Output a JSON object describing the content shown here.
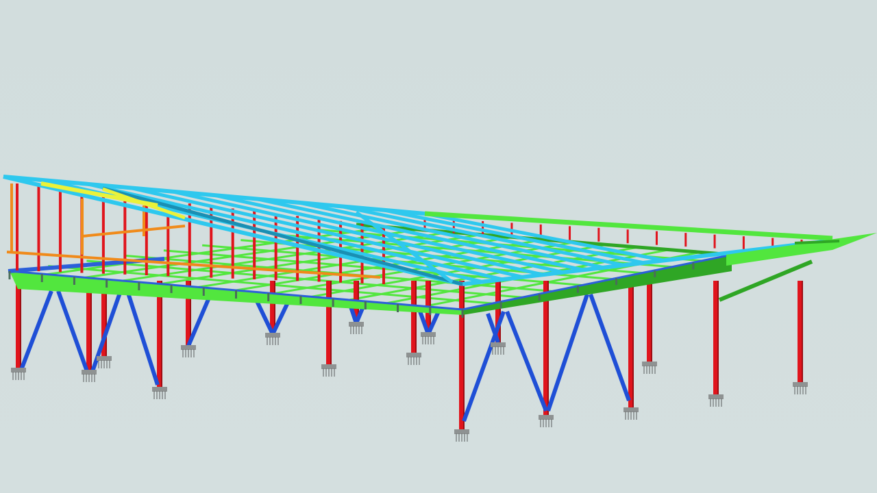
{
  "scene": {
    "subject": "structural-steel-frame-model",
    "background_color": "#d3dedf",
    "colors": {
      "column": "#e0141c",
      "column_dark": "#9e0c12",
      "brace": "#1f4fd6",
      "floor_beam": "#52e63e",
      "floor_beam_dark": "#2fa625",
      "floor_edge_blue": "#2c5fd9",
      "roof_beam": "#2ec8ee",
      "roof_beam_dark": "#1a8fb3",
      "roof_highlight": "#eaf23a",
      "rail": "#f08a1a",
      "base_plate": "#8e9292",
      "bolt": "#6d7172"
    }
  }
}
